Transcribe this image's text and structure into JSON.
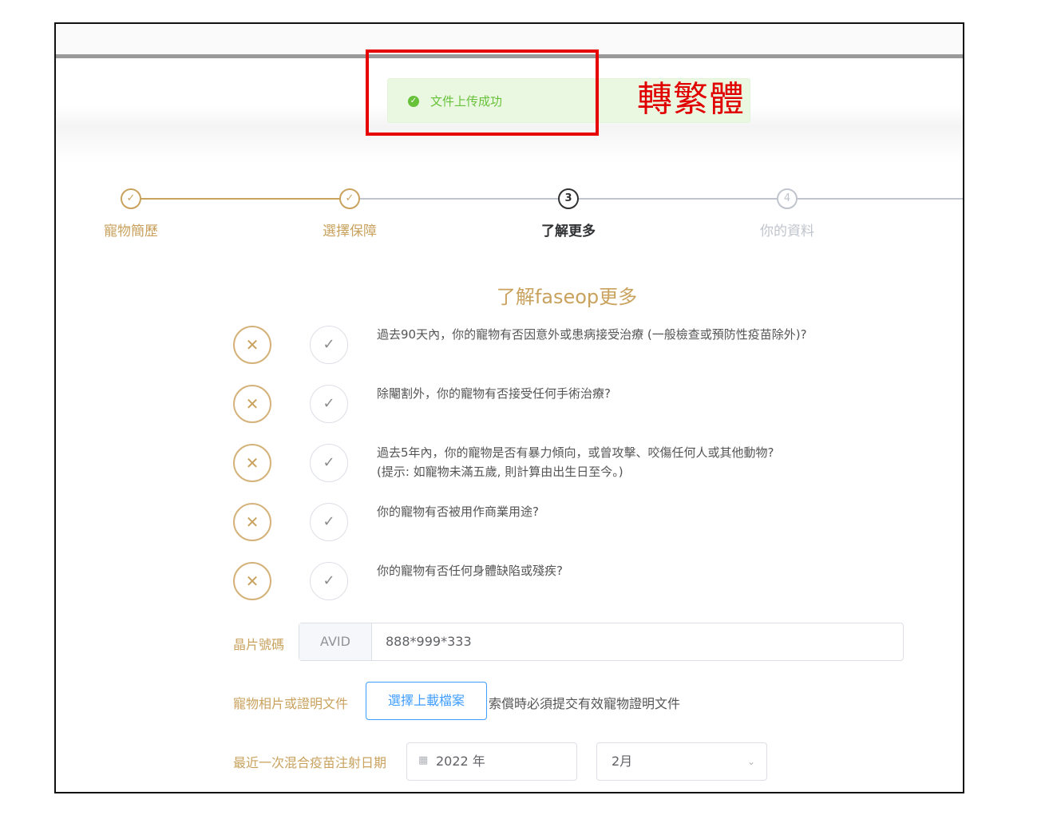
{
  "toast": {
    "icon": "check-circle-icon",
    "message": "文件上传成功",
    "color": "#67c23a"
  },
  "annotation": {
    "text": "轉繁體",
    "color": "#e00000"
  },
  "steps": [
    {
      "label": "寵物簡歷",
      "icon": "✓",
      "state": "done"
    },
    {
      "label": "選擇保障",
      "icon": "✓",
      "state": "done"
    },
    {
      "label": "了解更多",
      "icon": "3",
      "state": "active"
    },
    {
      "label": "你的資料",
      "icon": "4",
      "state": "pending"
    }
  ],
  "form": {
    "title": "了解faseop更多",
    "questions": [
      {
        "lines": [
          "過去90天內，你的寵物有否因意外或患病接受治療 (一般檢查或預防性疫苗除外)?"
        ]
      },
      {
        "lines": [
          "除閹割外，你的寵物有否接受任何手術治療?"
        ]
      },
      {
        "lines": [
          "過去5年內，你的寵物是否有暴力傾向，或曾攻擊、咬傷任何人或其他動物?",
          "(提示: 如寵物未滿五歲, 則計算由出生日至今。)"
        ]
      },
      {
        "lines": [
          "你的寵物有否被用作商業用途?"
        ]
      },
      {
        "lines": [
          "你的寵物有否任何身體缺陷或殘疾?"
        ]
      }
    ],
    "chip": {
      "label": "晶片號碼",
      "prefix": "AVID",
      "value": "888*999*333"
    },
    "upload": {
      "label": "寵物相片或證明文件",
      "button": "選擇上載檔案",
      "note": "索償時必須提交有效寵物證明文件"
    },
    "vaccine": {
      "label": "最近一次混合疫苗注射日期",
      "year": "2022 年",
      "month": "2月"
    }
  },
  "colors": {
    "accent": "#c9a25e",
    "link": "#409eff",
    "success": "#67c23a"
  }
}
